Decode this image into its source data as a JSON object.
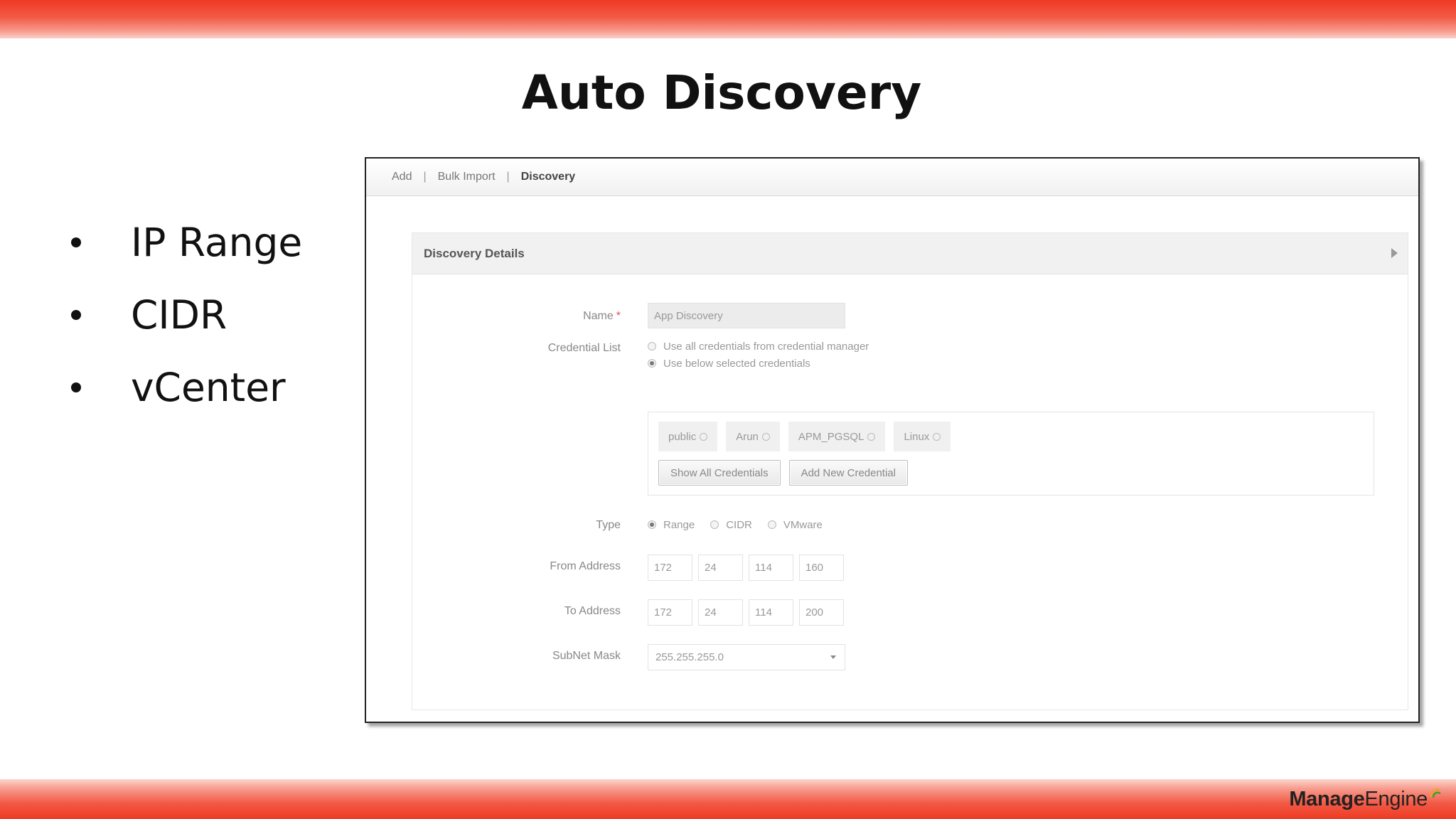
{
  "slide": {
    "title": "Auto Discovery",
    "bullets": [
      "IP Range",
      "CIDR",
      "vCenter"
    ],
    "logo": {
      "part1": "Manage",
      "part2": "Engine"
    },
    "colors": {
      "bar_red": "#ef3a24",
      "bar_light": "#fbd0c8"
    }
  },
  "screenshot": {
    "tabs": [
      {
        "label": "Add"
      },
      {
        "label": "Bulk Import"
      },
      {
        "label": "Discovery",
        "active": true
      }
    ],
    "panel_title": "Discovery Details",
    "name": {
      "label": "Name",
      "required_mark": "*",
      "value": "App Discovery"
    },
    "credential_list": {
      "label": "Credential List",
      "options": [
        {
          "label": "Use all credentials from credential manager",
          "selected": false
        },
        {
          "label": "Use below selected credentials",
          "selected": true
        }
      ],
      "chips": [
        "public",
        "Arun",
        "APM_PGSQL",
        "Linux"
      ],
      "buttons": [
        "Show All Credentials",
        "Add New Credential"
      ]
    },
    "type": {
      "label": "Type",
      "options": [
        {
          "label": "Range",
          "selected": true
        },
        {
          "label": "CIDR",
          "selected": false
        },
        {
          "label": "VMware",
          "selected": false
        }
      ]
    },
    "from_address": {
      "label": "From Address",
      "octets": [
        "172",
        "24",
        "114",
        "160"
      ]
    },
    "to_address": {
      "label": "To Address",
      "octets": [
        "172",
        "24",
        "114",
        "200"
      ]
    },
    "subnet_mask": {
      "label": "SubNet Mask",
      "value": "255.255.255.0"
    }
  }
}
